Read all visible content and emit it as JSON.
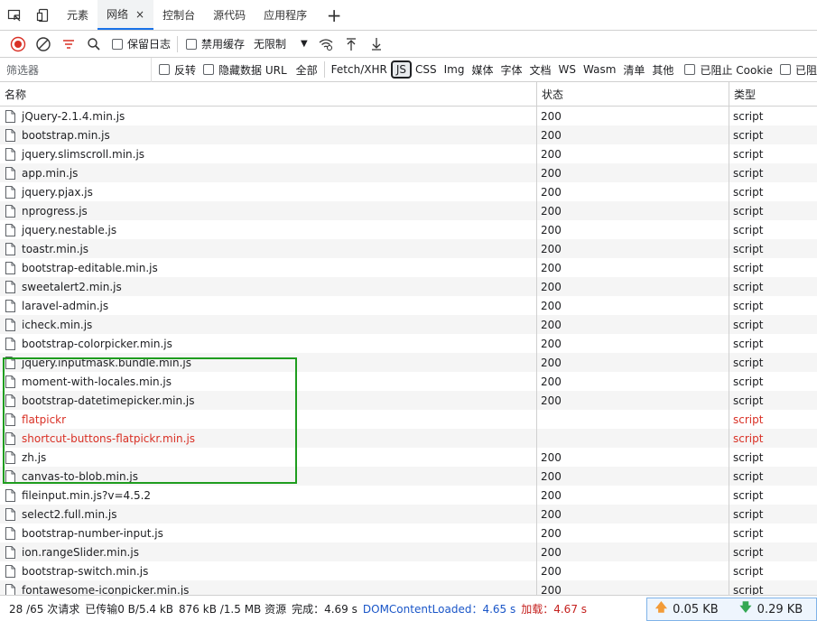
{
  "tabs": [
    {
      "label": "元素",
      "active": false
    },
    {
      "label": "网络",
      "active": true
    },
    {
      "label": "控制台",
      "active": false
    },
    {
      "label": "源代码",
      "active": false
    },
    {
      "label": "应用程序",
      "active": false
    }
  ],
  "tab_close": "×",
  "tab_add": "+",
  "toolbar": {
    "preserve_log": "保留日志",
    "disable_cache": "禁用缓存",
    "throttle_value": "无限制"
  },
  "filter": {
    "placeholder": "筛选器",
    "invert": "反转",
    "hide_data_url": "隐藏数据 URL",
    "types": [
      "全部",
      "Fetch/XHR",
      "JS",
      "CSS",
      "Img",
      "媒体",
      "字体",
      "文档",
      "WS",
      "Wasm",
      "清单",
      "其他"
    ],
    "active_type": "JS",
    "blocked_cookies": "已阻止 Cookie",
    "blocked_requests": "已阻"
  },
  "columns": {
    "name": "名称",
    "status": "状态",
    "type": "类型"
  },
  "rows": [
    {
      "name": "jQuery-2.1.4.min.js",
      "status": "200",
      "type": "script",
      "failed": false
    },
    {
      "name": "bootstrap.min.js",
      "status": "200",
      "type": "script",
      "failed": false
    },
    {
      "name": "jquery.slimscroll.min.js",
      "status": "200",
      "type": "script",
      "failed": false
    },
    {
      "name": "app.min.js",
      "status": "200",
      "type": "script",
      "failed": false
    },
    {
      "name": "jquery.pjax.js",
      "status": "200",
      "type": "script",
      "failed": false
    },
    {
      "name": "nprogress.js",
      "status": "200",
      "type": "script",
      "failed": false
    },
    {
      "name": "jquery.nestable.js",
      "status": "200",
      "type": "script",
      "failed": false
    },
    {
      "name": "toastr.min.js",
      "status": "200",
      "type": "script",
      "failed": false
    },
    {
      "name": "bootstrap-editable.min.js",
      "status": "200",
      "type": "script",
      "failed": false
    },
    {
      "name": "sweetalert2.min.js",
      "status": "200",
      "type": "script",
      "failed": false
    },
    {
      "name": "laravel-admin.js",
      "status": "200",
      "type": "script",
      "failed": false
    },
    {
      "name": "icheck.min.js",
      "status": "200",
      "type": "script",
      "failed": false
    },
    {
      "name": "bootstrap-colorpicker.min.js",
      "status": "200",
      "type": "script",
      "failed": false
    },
    {
      "name": "jquery.inputmask.bundle.min.js",
      "status": "200",
      "type": "script",
      "failed": false
    },
    {
      "name": "moment-with-locales.min.js",
      "status": "200",
      "type": "script",
      "failed": false
    },
    {
      "name": "bootstrap-datetimepicker.min.js",
      "status": "200",
      "type": "script",
      "failed": false
    },
    {
      "name": "flatpickr",
      "status": "",
      "type": "script",
      "failed": true
    },
    {
      "name": "shortcut-buttons-flatpickr.min.js",
      "status": "",
      "type": "script",
      "failed": true
    },
    {
      "name": "zh.js",
      "status": "200",
      "type": "script",
      "failed": false
    },
    {
      "name": "canvas-to-blob.min.js",
      "status": "200",
      "type": "script",
      "failed": false
    },
    {
      "name": "fileinput.min.js?v=4.5.2",
      "status": "200",
      "type": "script",
      "failed": false
    },
    {
      "name": "select2.full.min.js",
      "status": "200",
      "type": "script",
      "failed": false
    },
    {
      "name": "bootstrap-number-input.js",
      "status": "200",
      "type": "script",
      "failed": false
    },
    {
      "name": "ion.rangeSlider.min.js",
      "status": "200",
      "type": "script",
      "failed": false
    },
    {
      "name": "bootstrap-switch.min.js",
      "status": "200",
      "type": "script",
      "failed": false
    },
    {
      "name": "fontawesome-iconpicker.min.js",
      "status": "200",
      "type": "script",
      "failed": false
    }
  ],
  "status_bar": {
    "requests": "28 /65 次请求",
    "transferred": "已传输0 B/5.4 kB",
    "resources": "876 kB /1.5 MB 资源",
    "finish": "完成：4.69 s",
    "dom_loaded": "DOMContentLoaded：4.65 s",
    "load": "加载：4.67 s",
    "upload_speed": "0.05 KB",
    "download_speed": "0.29 KB"
  },
  "colors": {
    "accent": "#1a73e8",
    "record": "#d93025",
    "failed": "#d93025",
    "highlight": "#1f9d1f"
  }
}
